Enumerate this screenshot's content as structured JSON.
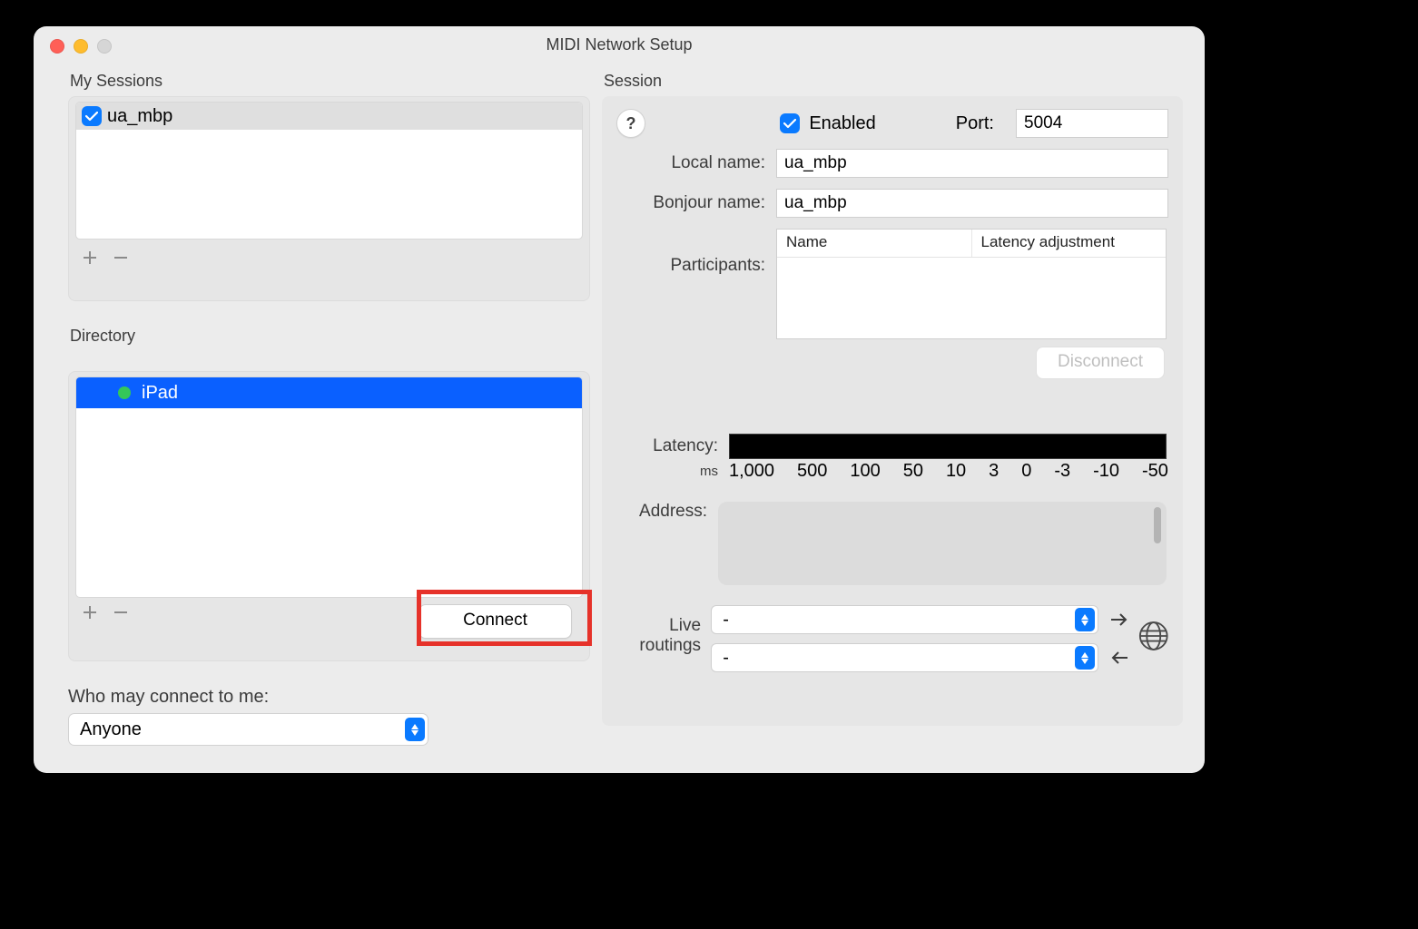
{
  "window": {
    "title": "MIDI Network Setup"
  },
  "left": {
    "sessions_label": "My Sessions",
    "sessions": [
      {
        "checked": true,
        "name": "ua_mbp"
      }
    ],
    "directory_label": "Directory",
    "directory": [
      {
        "online": true,
        "name": "iPad",
        "selected": true
      }
    ],
    "connect_button": "Connect",
    "who_label": "Who may connect to me:",
    "who_value": "Anyone"
  },
  "right": {
    "section_label": "Session",
    "enabled_label": "Enabled",
    "enabled": true,
    "port_label": "Port:",
    "port": "5004",
    "local_name_label": "Local name:",
    "local_name": "ua_mbp",
    "bonjour_name_label": "Bonjour name:",
    "bonjour_name": "ua_mbp",
    "participants_label": "Participants:",
    "participants_cols": {
      "name": "Name",
      "latency": "Latency adjustment"
    },
    "disconnect": "Disconnect",
    "latency_label": "Latency:",
    "latency_unit": "ms",
    "latency_ticks": [
      "1,000",
      "500",
      "100",
      "50",
      "10",
      "3",
      "0",
      "-3",
      "-10",
      "-50"
    ],
    "address_label": "Address:",
    "live_label_top": "Live",
    "live_label_bottom": "routings",
    "live_route_a": "-",
    "live_route_b": "-"
  }
}
